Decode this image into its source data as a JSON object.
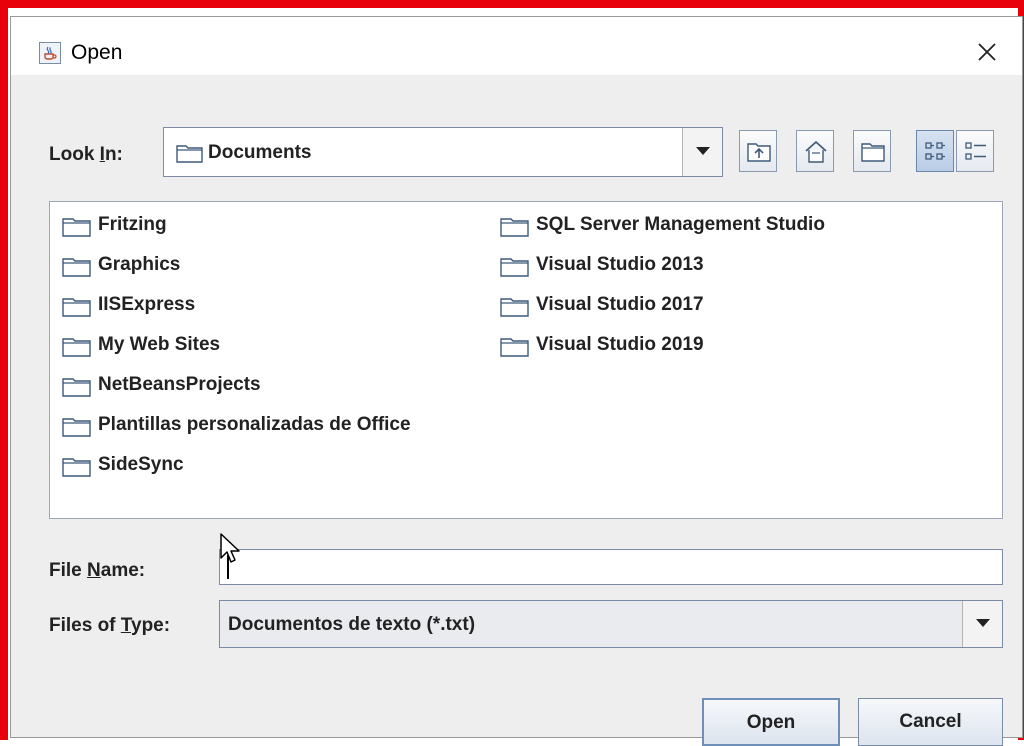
{
  "window": {
    "title": "Open",
    "close_icon": "close-icon",
    "app_icon": "java-cup-icon"
  },
  "look_in": {
    "label_pre": "Look ",
    "label_mnemonic": "I",
    "label_post": "n:",
    "value": "Documents"
  },
  "toolbar": {
    "buttons": [
      "up-one-level-icon",
      "home-icon",
      "new-folder-icon",
      "list-view-icon",
      "details-view-icon"
    ]
  },
  "files": {
    "column1": [
      "Fritzing",
      "Graphics",
      "IISExpress",
      "My Web Sites",
      "NetBeansProjects",
      "Plantillas personalizadas de Office",
      "SideSync"
    ],
    "column2": [
      "SQL Server Management Studio",
      "Visual Studio 2013",
      "Visual Studio 2017",
      "Visual Studio 2019"
    ]
  },
  "file_name": {
    "label_pre": "File ",
    "label_mnemonic": "N",
    "label_post": "ame:",
    "value": ""
  },
  "file_type": {
    "label_pre": "Files of ",
    "label_mnemonic": "T",
    "label_post": "ype:",
    "value": "Documentos de texto (*.txt)"
  },
  "buttons": {
    "open": "Open",
    "cancel": "Cancel"
  },
  "colors": {
    "frame_border": "#e8000b",
    "dialog_bg": "#eeeeee"
  }
}
